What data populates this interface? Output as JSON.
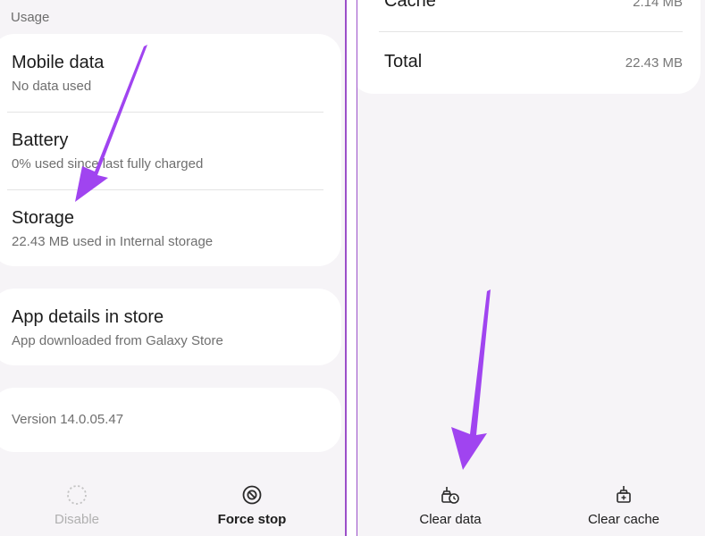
{
  "left": {
    "section_title": "Usage",
    "items": [
      {
        "title": "Mobile data",
        "subtitle": "No data used"
      },
      {
        "title": "Battery",
        "subtitle": "0% used since last fully charged"
      },
      {
        "title": "Storage",
        "subtitle": "22.43 MB used in Internal storage"
      }
    ],
    "store": {
      "title": "App details in store",
      "subtitle": "App downloaded from Galaxy Store"
    },
    "version": "Version 14.0.05.47",
    "buttons": {
      "disable": "Disable",
      "force_stop": "Force stop"
    }
  },
  "right": {
    "rows": [
      {
        "name": "Cache",
        "value": "2.14 MB"
      },
      {
        "name": "Total",
        "value": "22.43 MB"
      }
    ],
    "buttons": {
      "clear_data": "Clear data",
      "clear_cache": "Clear cache"
    }
  },
  "colors": {
    "annotation_arrow": "#a044f0",
    "divider": "#9b4fc9"
  }
}
